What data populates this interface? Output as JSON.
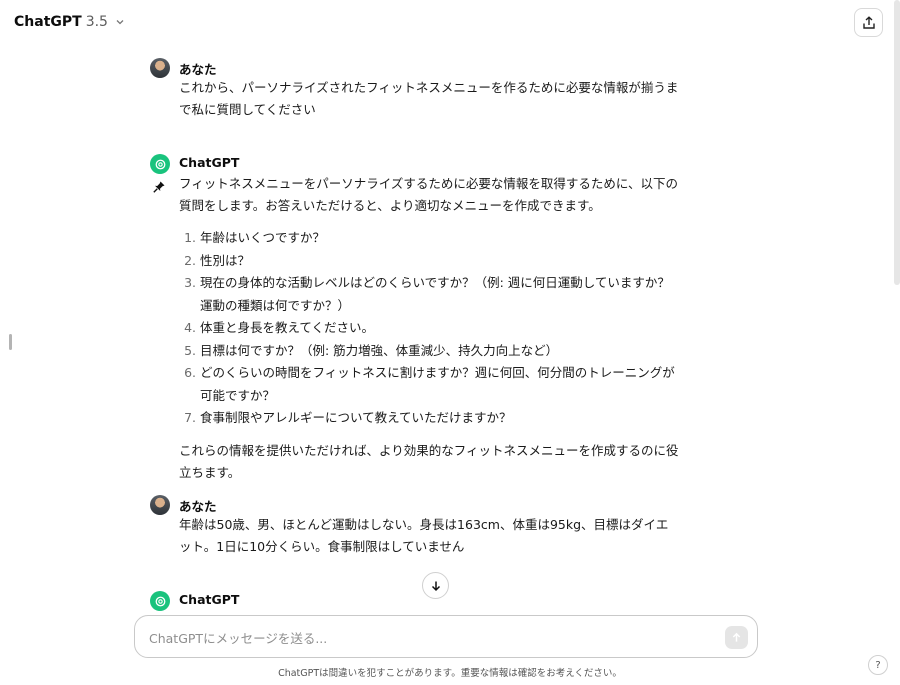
{
  "header": {
    "model_name": "ChatGPT",
    "model_version": "3.5",
    "share_icon": "share-upload-icon"
  },
  "conversation": [
    {
      "role": "user",
      "author": "あなた",
      "text": "これから、パーソナライズされたフィットネスメニューを作るために必要な情報が揃うまで私に質問してください"
    },
    {
      "role": "assistant",
      "author": "ChatGPT",
      "intro": "フィットネスメニューをパーソナライズするために必要な情報を取得するために、以下の質問をします。お答えいただけると、より適切なメニューを作成できます。",
      "questions": [
        "年齢はいくつですか？",
        "性別は？",
        "現在の身体的な活動レベルはどのくらいですか？（例: 週に何日運動していますか？運動の種類は何ですか？）",
        "体重と身長を教えてください。",
        "目標は何ですか？（例: 筋力増強、体重減少、持久力向上など）",
        "どのくらいの時間をフィットネスに割けますか？週に何回、何分間のトレーニングが可能ですか？",
        "食事制限やアレルギーについて教えていただけますか？"
      ],
      "outro": "これらの情報を提供いただければ、より効果的なフィットネスメニューを作成するのに役立ちます。"
    },
    {
      "role": "user",
      "author": "あなた",
      "text": "年齢は50歳、男、ほとんど運動はしない。身長は163cm、体重は95kg、目標はダイエット。1日に10分くらい。食事制限はしていません"
    },
    {
      "role": "assistant",
      "author": "ChatGPT"
    }
  ],
  "composer": {
    "placeholder": "ChatGPTにメッセージを送る..."
  },
  "footer": {
    "note": "ChatGPTは間違いを犯すことがあります。重要な情報は確認をお考えください。",
    "help_label": "?"
  },
  "colors": {
    "brand": "#19c37d",
    "text": "#0d0d0d",
    "border": "#c9c9c9"
  }
}
